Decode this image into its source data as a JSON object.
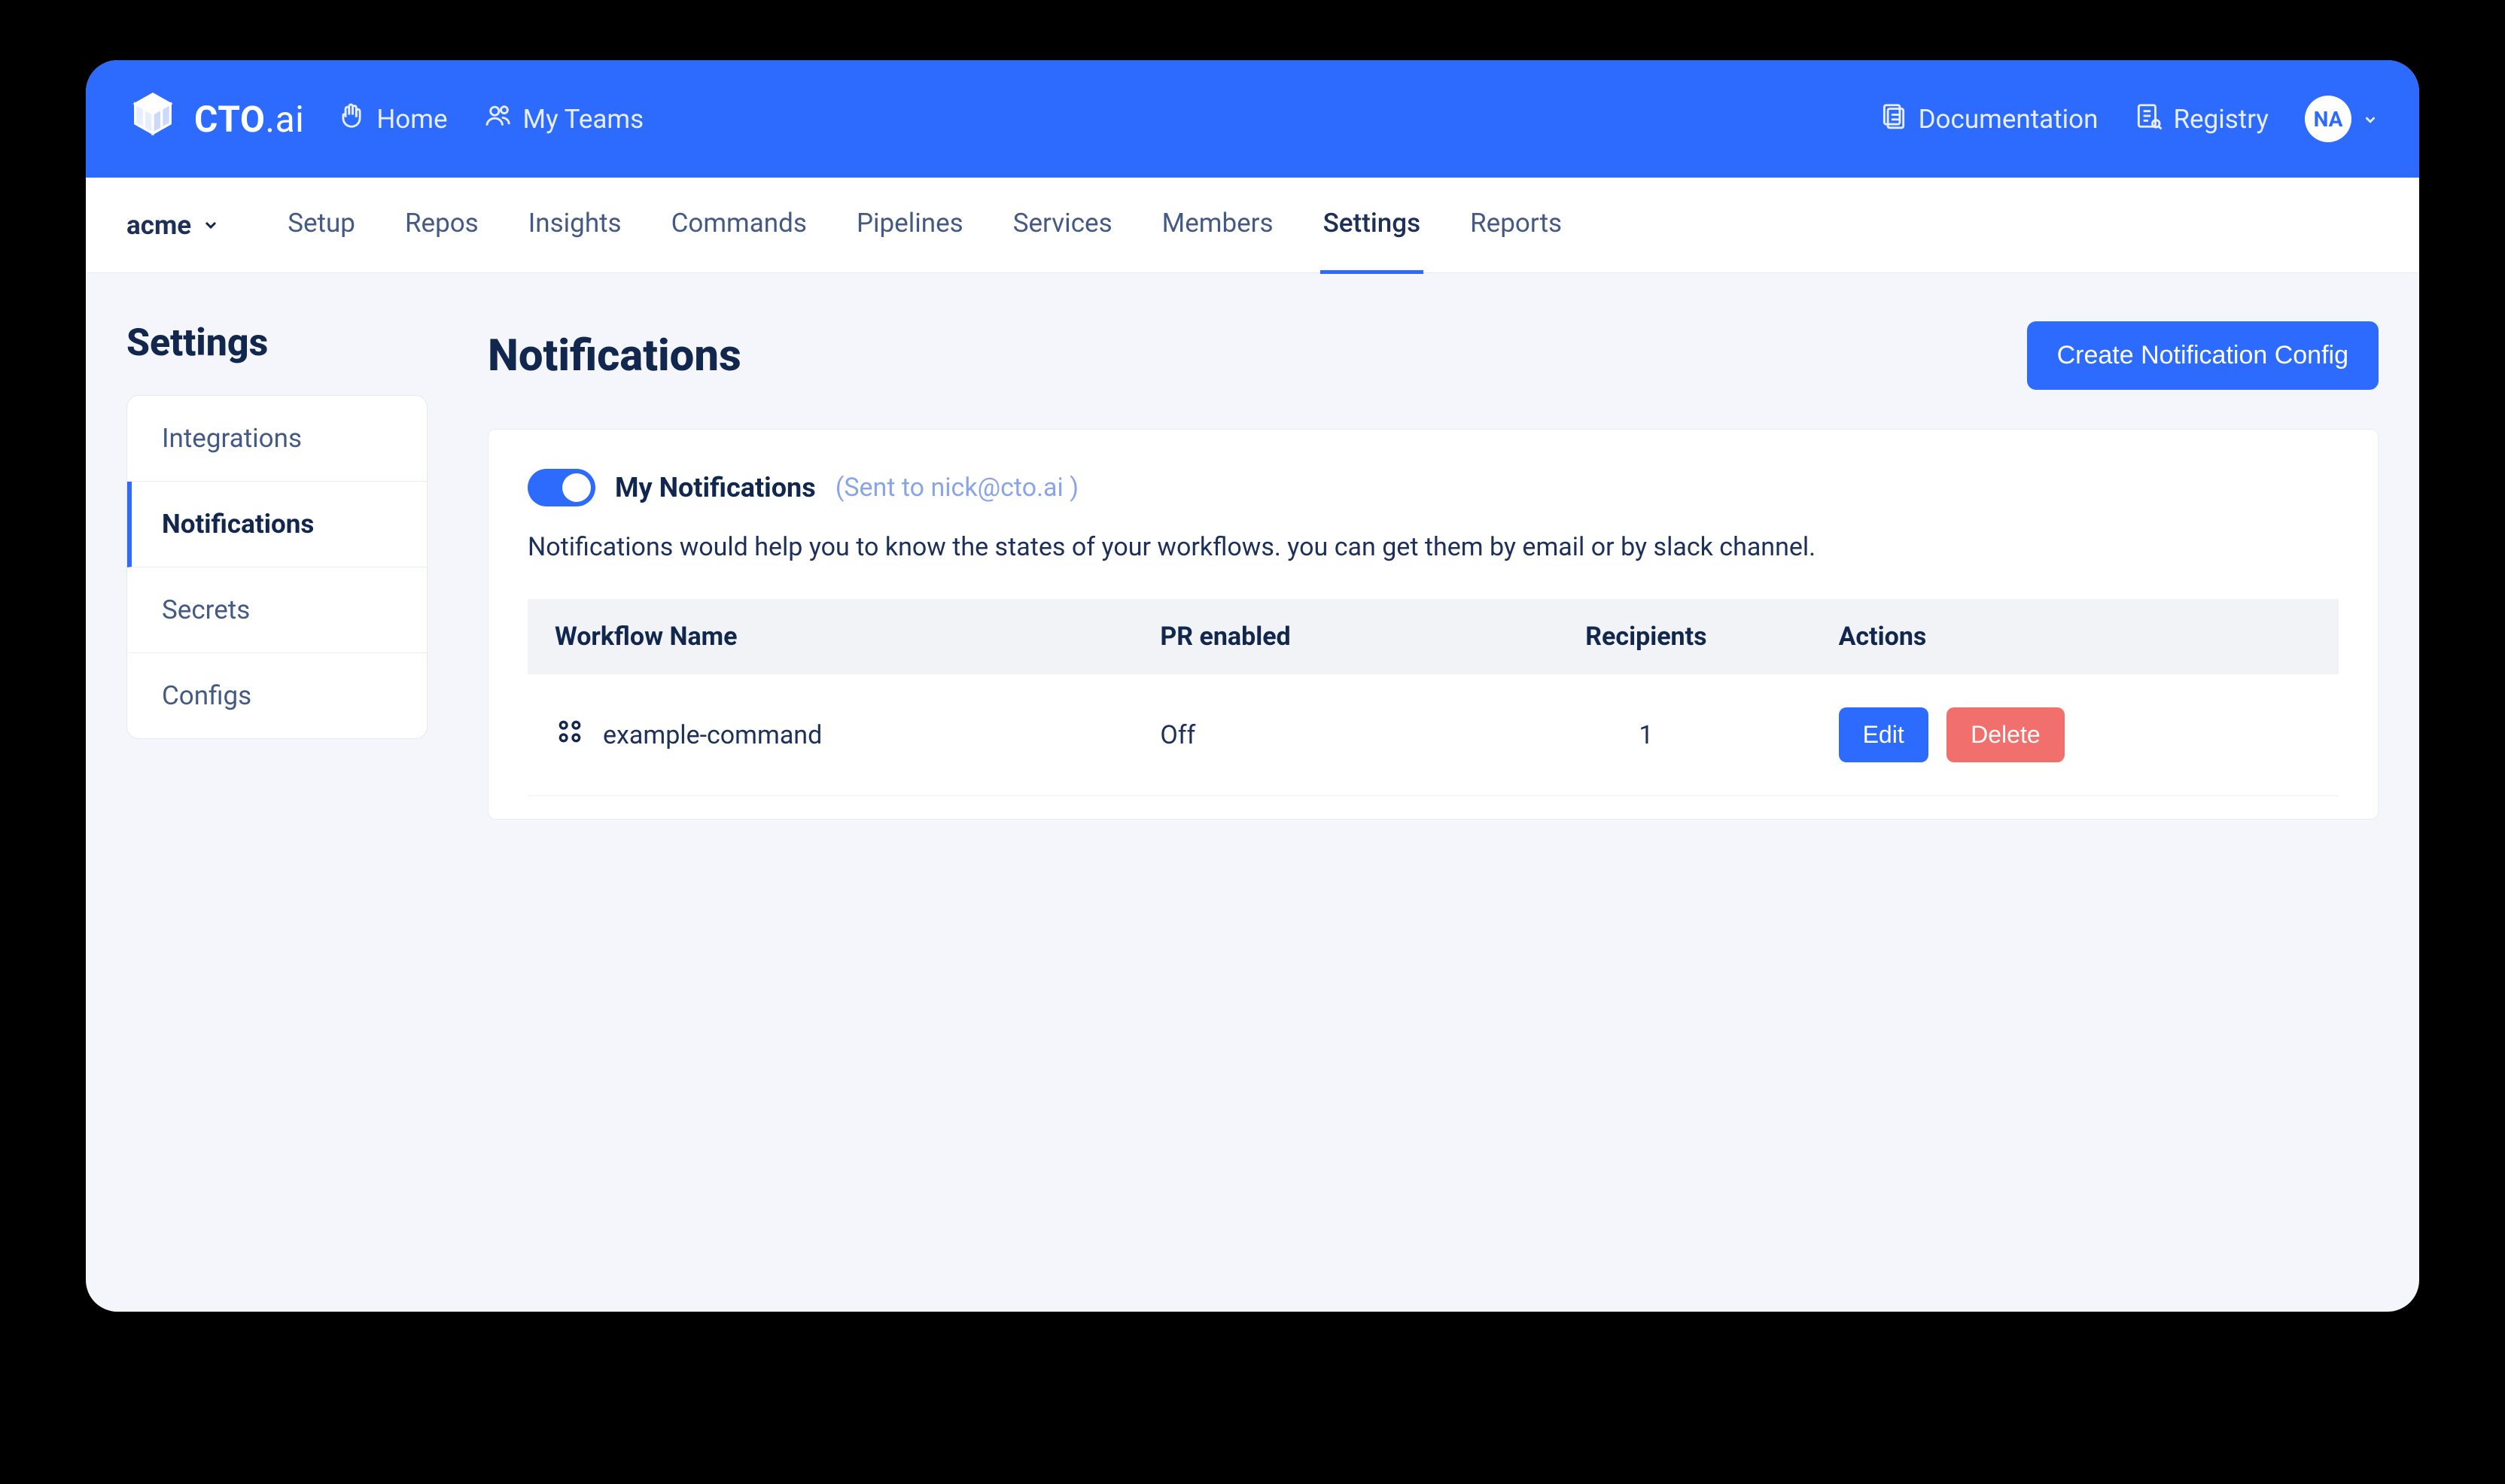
{
  "brand": {
    "name_bold": "CTO",
    "name_thin": ".ai"
  },
  "topnav": {
    "home": "Home",
    "myteams": "My Teams",
    "documentation": "Documentation",
    "registry": "Registry"
  },
  "user": {
    "initials": "NA"
  },
  "team": {
    "name": "acme"
  },
  "subtabs": {
    "setup": "Setup",
    "repos": "Repos",
    "insights": "Insights",
    "commands": "Commands",
    "pipelines": "Pipelines",
    "services": "Services",
    "members": "Members",
    "settings": "Settings",
    "reports": "Reports"
  },
  "sidebar": {
    "title": "Settings",
    "items": {
      "integrations": "Integrations",
      "notifications": "Notifications",
      "secrets": "Secrets",
      "configs": "Configs"
    }
  },
  "main": {
    "title": "Notifications",
    "create_btn": "Create Notification Config",
    "toggle_label": "My Notifications",
    "toggle_sub": "(Sent to nick@cto.ai )",
    "description": "Notifications would help you to know the states of your workflows. you can get them by email or by slack channel."
  },
  "table": {
    "headers": {
      "name": "Workflow Name",
      "pr": "PR enabled",
      "recipients": "Recipients",
      "actions": "Actions"
    },
    "rows": [
      {
        "name": "example-command",
        "pr": "Off",
        "recipients": "1",
        "edit": "Edit",
        "delete": "Delete"
      }
    ]
  }
}
